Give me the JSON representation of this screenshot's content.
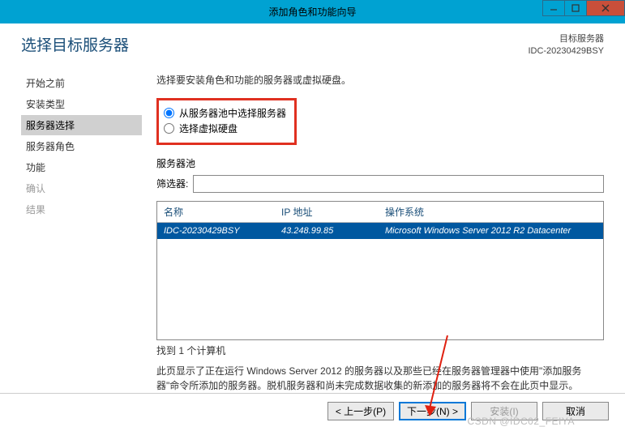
{
  "window": {
    "title": "添加角色和功能向导"
  },
  "header": {
    "page_title": "选择目标服务器",
    "target_label": "目标服务器",
    "target_name": "IDC-20230429BSY"
  },
  "sidebar": {
    "items": [
      {
        "label": "开始之前",
        "state": ""
      },
      {
        "label": "安装类型",
        "state": ""
      },
      {
        "label": "服务器选择",
        "state": "active"
      },
      {
        "label": "服务器角色",
        "state": ""
      },
      {
        "label": "功能",
        "state": ""
      },
      {
        "label": "确认",
        "state": "disabled"
      },
      {
        "label": "结果",
        "state": "disabled"
      }
    ]
  },
  "main": {
    "instruction": "选择要安装角色和功能的服务器或虚拟硬盘。",
    "radio1": "从服务器池中选择服务器",
    "radio2": "选择虚拟硬盘",
    "pool_title": "服务器池",
    "filter_label": "筛选器:",
    "filter_value": "",
    "columns": {
      "name": "名称",
      "ip": "IP 地址",
      "os": "操作系统"
    },
    "rows": [
      {
        "name": "IDC-20230429BSY",
        "ip": "43.248.99.85",
        "os": "Microsoft Windows Server 2012 R2 Datacenter"
      }
    ],
    "found_text": "找到 1 个计算机",
    "description": "此页显示了正在运行 Windows Server 2012 的服务器以及那些已经在服务器管理器中使用\"添加服务器\"命令所添加的服务器。脱机服务器和尚未完成数据收集的新添加的服务器将不会在此页中显示。"
  },
  "footer": {
    "prev": "< 上一步(P)",
    "next": "下一步(N) >",
    "install": "安装(I)",
    "cancel": "取消"
  },
  "watermark": "CSDN @IDC02_FEIYA"
}
